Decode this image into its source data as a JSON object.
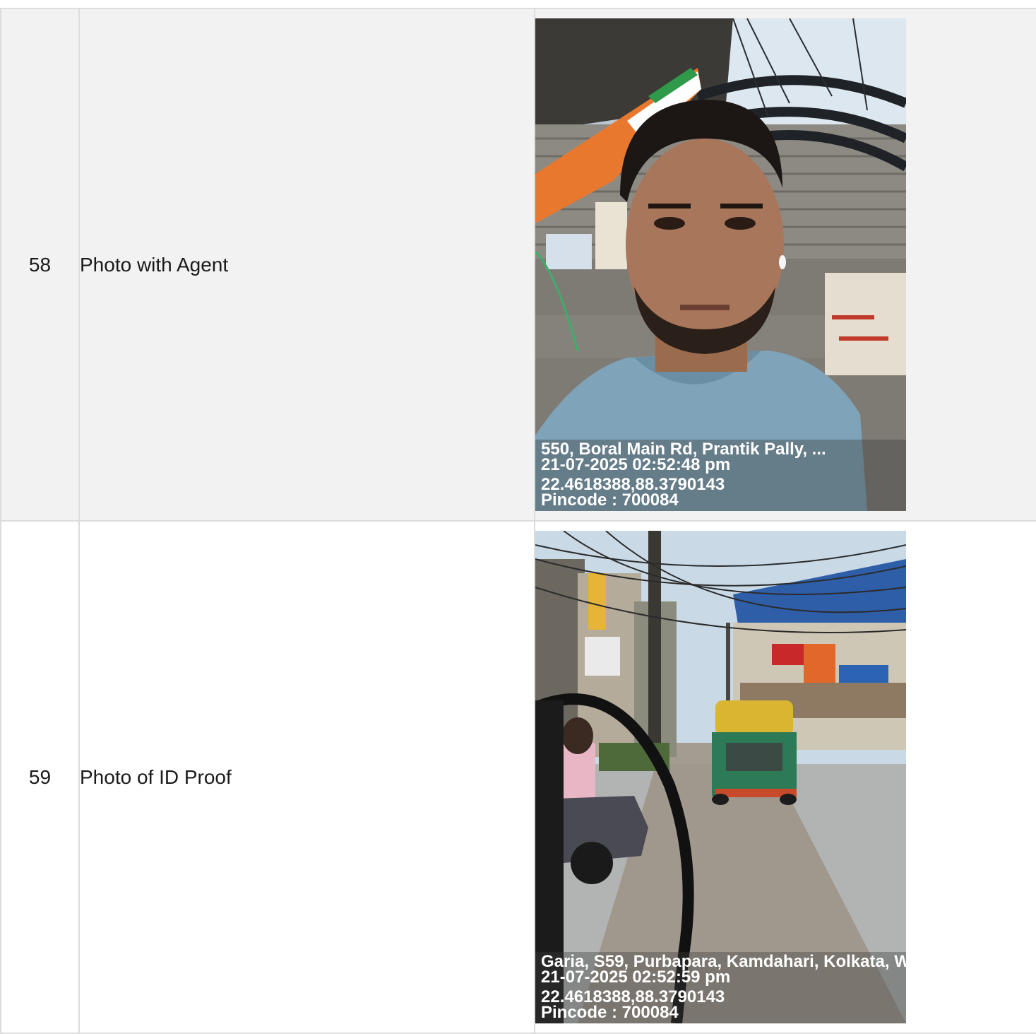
{
  "rows": [
    {
      "number": "58",
      "label": "Photo with Agent",
      "photo": {
        "subject": "selfie of man in blue t-shirt in front of corrugated metal shed with flag and posters",
        "stamp": {
          "address": "550, Boral Main Rd, Prantik Pally, ...",
          "datetime": "21-07-2025 02:52:48 pm",
          "coordinates": "22.4618388,88.3790143",
          "pincode": "Pincode : 700084"
        }
      }
    },
    {
      "number": "59",
      "label": "Photo of ID Proof",
      "photo": {
        "subject": "street scene with yellow-green auto rickshaw, shops, overhead wires and black cable",
        "stamp": {
          "address": "Garia, S59, Purbapara, Kamdahari, Kolkata, W",
          "datetime": "21-07-2025 02:52:59 pm",
          "coordinates": "22.4618388,88.3790143",
          "pincode": "Pincode : 700084"
        }
      }
    }
  ]
}
